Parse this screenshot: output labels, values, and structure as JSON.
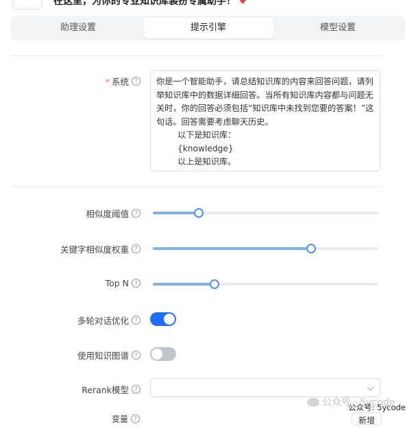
{
  "header": {
    "description_partial": "在这里，为你的专业知识库装扮专属助手！",
    "heart_icon": "heart-icon"
  },
  "tabs": [
    {
      "label": "助理设置",
      "active": false
    },
    {
      "label": "提示引擎",
      "active": true
    },
    {
      "label": "模型设置",
      "active": false
    }
  ],
  "system": {
    "label": "系统",
    "required_mark": "*",
    "value": "你是一个智能助手，请总结知识库的内容来回答问题，请列举知识库中的数据详细回答。当所有知识库内容都与问题无关时，你的回答必须包括“知识库中未找到您要的答案！”这句话。回答需要考虑聊天历史。\n        以下是知识库：\n        {knowledge}\n        以上是知识库。"
  },
  "similarity_threshold": {
    "label": "相似度阈值",
    "value_fraction": 0.2
  },
  "keyword_weight": {
    "label": "关键字相似度权重",
    "value_fraction": 0.7
  },
  "top_n": {
    "label": "Top N",
    "value_fraction": 0.27
  },
  "multi_turn": {
    "label": "多轮对话优化",
    "enabled": true
  },
  "knowledge_graph": {
    "label": "使用知识图谱",
    "enabled": false
  },
  "rerank": {
    "label": "Rerank模型",
    "selected": ""
  },
  "variables": {
    "label_partial": "变量",
    "add_button": "新增"
  },
  "footer": {
    "watermark": "公众号 · 5ycode",
    "credit": "公众号: 5ycode"
  },
  "colors": {
    "primary": "#1f6fff",
    "slider_fill": "#7ab2f5",
    "required": "#f56c6c"
  }
}
